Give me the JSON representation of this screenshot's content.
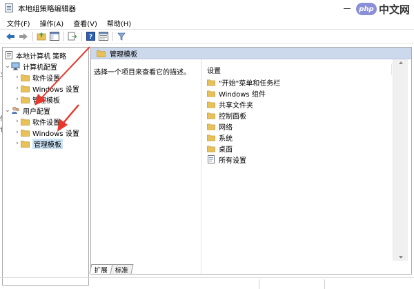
{
  "window": {
    "title": "本地组策略编辑器",
    "watermark_logo": "php",
    "watermark_text": "中文网"
  },
  "menu": {
    "items": [
      "文件(F)",
      "操作(A)",
      "查看(V)",
      "帮助(H)"
    ]
  },
  "toolbar": {
    "icons": [
      "back-icon",
      "forward-icon",
      "up-folder-icon",
      "show-hide-tree-icon",
      "export-list-icon",
      "help-icon",
      "properties-view-icon",
      "filter-icon"
    ]
  },
  "tree": {
    "root": "本地计算机 策略",
    "computer_config": "计算机配置",
    "user_config": "用户配置",
    "children": [
      "软件设置",
      "Windows 设置",
      "管理模板"
    ]
  },
  "edge_fragments": [
    "义",
    "侶",
    "讠"
  ],
  "content": {
    "header": "管理模板",
    "description": "选择一个项目来查看它的描述。",
    "column_header": "设置",
    "items": [
      {
        "label": "\"开始\"菜单和任务栏",
        "icon": "folder-icon"
      },
      {
        "label": "Windows 组件",
        "icon": "folder-icon"
      },
      {
        "label": "共享文件夹",
        "icon": "folder-icon"
      },
      {
        "label": "控制面板",
        "icon": "folder-icon"
      },
      {
        "label": "网络",
        "icon": "folder-icon"
      },
      {
        "label": "系统",
        "icon": "folder-icon"
      },
      {
        "label": "桌面",
        "icon": "folder-icon"
      },
      {
        "label": "所有设置",
        "icon": "settings-list-icon"
      }
    ]
  },
  "tabs": [
    "扩展",
    "标准"
  ],
  "colors": {
    "header_bg": "#ccd8ec",
    "selection": "#cce4f7",
    "folder": "#e8c15a",
    "arrow": "#e8372c"
  }
}
